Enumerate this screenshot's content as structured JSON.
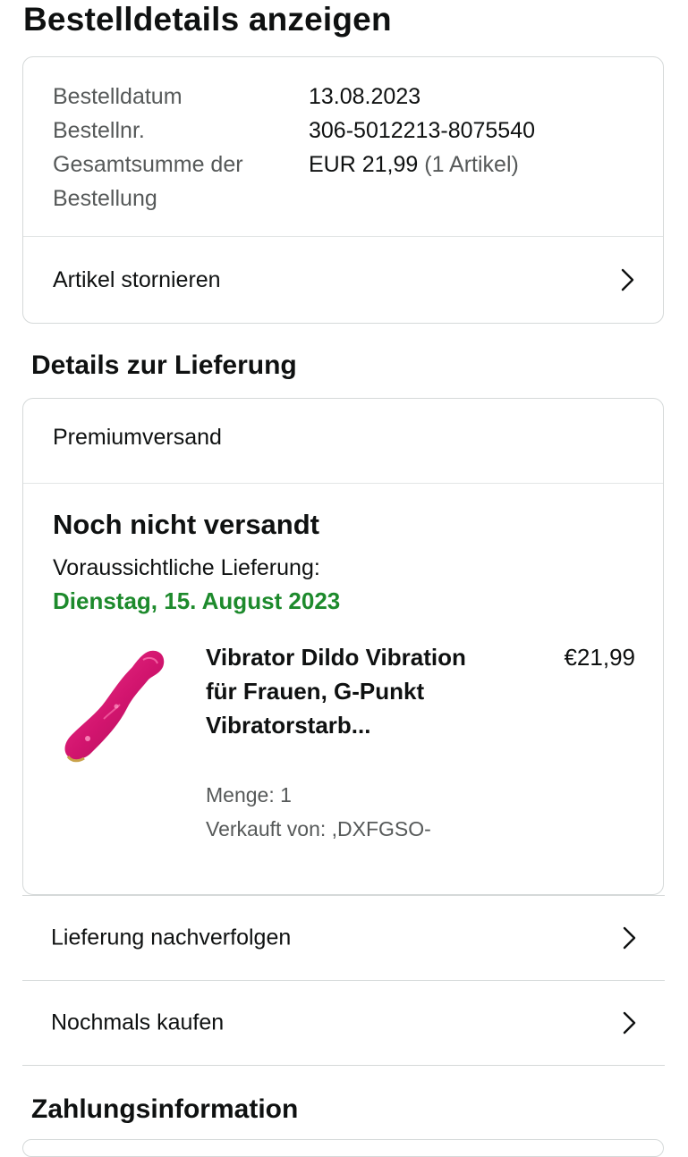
{
  "page": {
    "title": "Bestelldetails anzeigen"
  },
  "summary": {
    "rows": [
      {
        "label": "Bestelldatum",
        "value": "13.08.2023"
      },
      {
        "label": "Bestellnr.",
        "value": "306-5012213-8075540"
      },
      {
        "label": "Gesamtsumme der Bestellung",
        "value": "EUR 21,99",
        "note": "(1 Artikel)"
      }
    ],
    "cancel_label": "Artikel stornieren"
  },
  "delivery": {
    "section_title": "Details zur Lieferung",
    "shipping_method": "Premiumversand",
    "status": "Noch nicht versandt",
    "eta_label": "Voraussichtliche Lieferung:",
    "eta_date": "Dienstag, 15. August 2023",
    "item": {
      "title": "Vibrator Dildo Vibration für Frauen, G-Punkt Vibratorstarb...",
      "price": "€21,99",
      "quantity": "Menge: 1",
      "seller": "Verkauft von: ,DXFGSO-",
      "image_icon": "product-image"
    }
  },
  "actions": {
    "track": "Lieferung nachverfolgen",
    "buy_again": "Nochmals kaufen"
  },
  "payment": {
    "section_title": "Zahlungsinformation"
  },
  "colors": {
    "delivery_date": "#1d8a2c",
    "border": "#d5d9d9",
    "muted_text": "#565959",
    "product_pink": "#d3156f"
  }
}
